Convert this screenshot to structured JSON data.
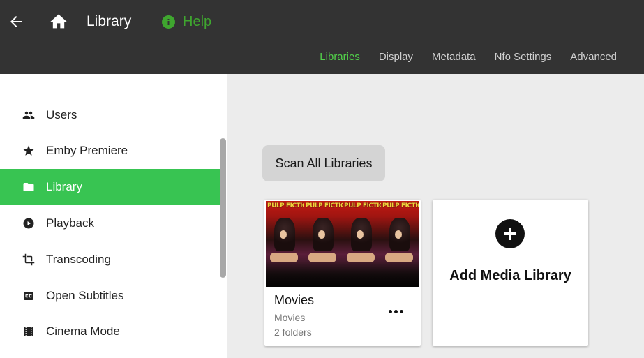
{
  "header": {
    "title": "Library",
    "help_label": "Help",
    "back_icon": "arrow-left-icon",
    "home_icon": "home-icon",
    "help_icon": "info-circle-icon",
    "background": "#333333"
  },
  "tabs": [
    {
      "label": "Libraries",
      "active": true
    },
    {
      "label": "Display",
      "active": false
    },
    {
      "label": "Metadata",
      "active": false
    },
    {
      "label": "Nfo Settings",
      "active": false
    },
    {
      "label": "Advanced",
      "active": false
    }
  ],
  "sidebar": {
    "items": [
      {
        "label": "Users",
        "icon": "people-icon",
        "active": false
      },
      {
        "label": "Emby Premiere",
        "icon": "star-icon",
        "active": false
      },
      {
        "label": "Library",
        "icon": "folder-icon",
        "active": true
      },
      {
        "label": "Playback",
        "icon": "play-circle-icon",
        "active": false
      },
      {
        "label": "Transcoding",
        "icon": "crop-icon",
        "active": false
      },
      {
        "label": "Open Subtitles",
        "icon": "subtitles-icon",
        "active": false
      },
      {
        "label": "Cinema Mode",
        "icon": "film-icon",
        "active": false
      }
    ]
  },
  "main": {
    "scan_button": "Scan All Libraries",
    "libraries": [
      {
        "name": "Movies",
        "type": "Movies",
        "folders": "2 folders",
        "poster_title": "PULP FICTION"
      }
    ],
    "add_library_label": "Add Media Library"
  },
  "colors": {
    "accent_green": "#38c452",
    "active_tab": "#52d24a",
    "help_green": "#3fa62f"
  }
}
